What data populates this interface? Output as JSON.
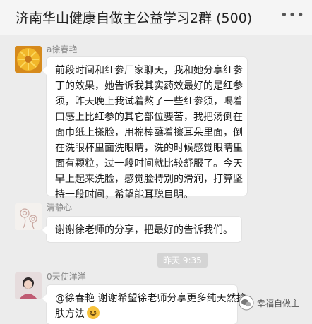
{
  "header": {
    "title": "济南华山健康自做主公益学习2群 (500)",
    "more_icon": "more-dots-icon"
  },
  "messages": [
    {
      "sender": "a徐春艳",
      "avatar": "chrysanthemum-photo",
      "lines": [
        "前段时间和红参厂家聊天，我和她分享红参",
        "丁的效果，她告诉我其实药效最好的是红参",
        "须，昨天晚上我试着熬了一些红参须，喝着",
        "口感上比红参的其它部位要苦，我把汤倒在",
        "面巾纸上搽脸，用棉棒蘸着擦耳朵里面，倒",
        "在洗眼杯里面洗眼睛，洗的时候感觉眼睛里",
        "面有颗粒，过一段时间就比较舒服了。今天",
        "早上起来洗脸，感觉脸特别的滑润，打算坚",
        "持一段时间，希望能耳聪目明。"
      ]
    },
    {
      "sender": "清静心",
      "avatar": "flower-sketch",
      "lines": [
        "谢谢徐老师的分享，把最好的告诉我们。"
      ]
    },
    {
      "sender": "0天使洋洋",
      "avatar": "portrait-photo",
      "lines": [
        "@徐春艳 谢谢希望徐老师分享更多纯天然护",
        "肤方法"
      ]
    }
  ],
  "timestamp": "昨天 9:35",
  "watermark": {
    "text": "幸福自做主"
  },
  "colors": {
    "background": "#ececec",
    "bubble": "#ffffff",
    "header": "#f5f5f5",
    "time_pill": "#d4d4d4"
  }
}
